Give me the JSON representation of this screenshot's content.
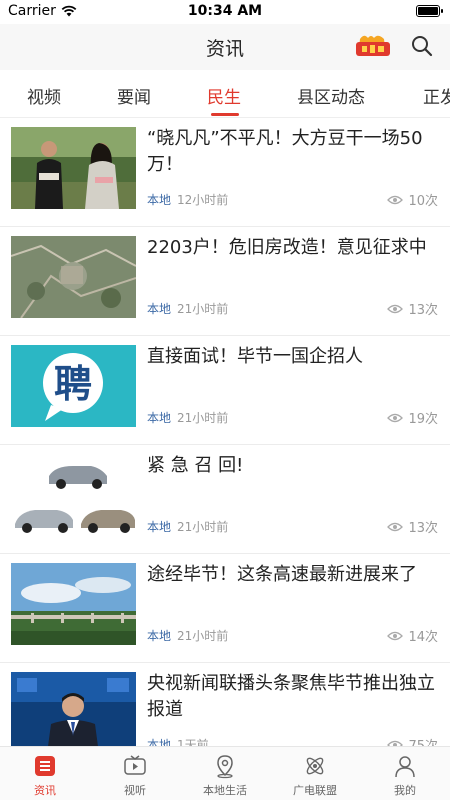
{
  "status_bar": {
    "carrier": "Carrier",
    "time": "10:34 AM"
  },
  "header": {
    "title": "资讯",
    "hot_badge_icon": "hot-list-badge-icon",
    "accent": "#e03a2e"
  },
  "tabs": [
    {
      "label": "视频"
    },
    {
      "label": "要闻"
    },
    {
      "label": "民生",
      "active": true
    },
    {
      "label": "县区动态"
    },
    {
      "label": "正发"
    }
  ],
  "news": [
    {
      "title": "“晓凡凡”不平凡！大方豆干一场50万！",
      "source": "本地",
      "time": "12小时前",
      "views": "10次"
    },
    {
      "title": "2203户！危旧房改造！意见征求中",
      "source": "本地",
      "time": "21小时前",
      "views": "13次"
    },
    {
      "title": "直接面试！毕节一国企招人",
      "source": "本地",
      "time": "21小时前",
      "views": "19次",
      "thumb_text": "聘"
    },
    {
      "title": "紧 急 召 回!",
      "source": "本地",
      "time": "21小时前",
      "views": "13次"
    },
    {
      "title": "途经毕节！这条高速最新进展来了",
      "source": "本地",
      "time": "21小时前",
      "views": "14次"
    },
    {
      "title": "央视新闻联播头条聚焦毕节推出独立报道",
      "source": "本地",
      "time": "1天前",
      "views": "75次"
    }
  ],
  "bottom_tabs": [
    {
      "label": "资讯",
      "icon": "news-list-icon",
      "active": true
    },
    {
      "label": "视听",
      "icon": "tv-play-icon"
    },
    {
      "label": "本地生活",
      "icon": "location-pin-icon"
    },
    {
      "label": "广电联盟",
      "icon": "atom-icon"
    },
    {
      "label": "我的",
      "icon": "user-icon"
    }
  ]
}
